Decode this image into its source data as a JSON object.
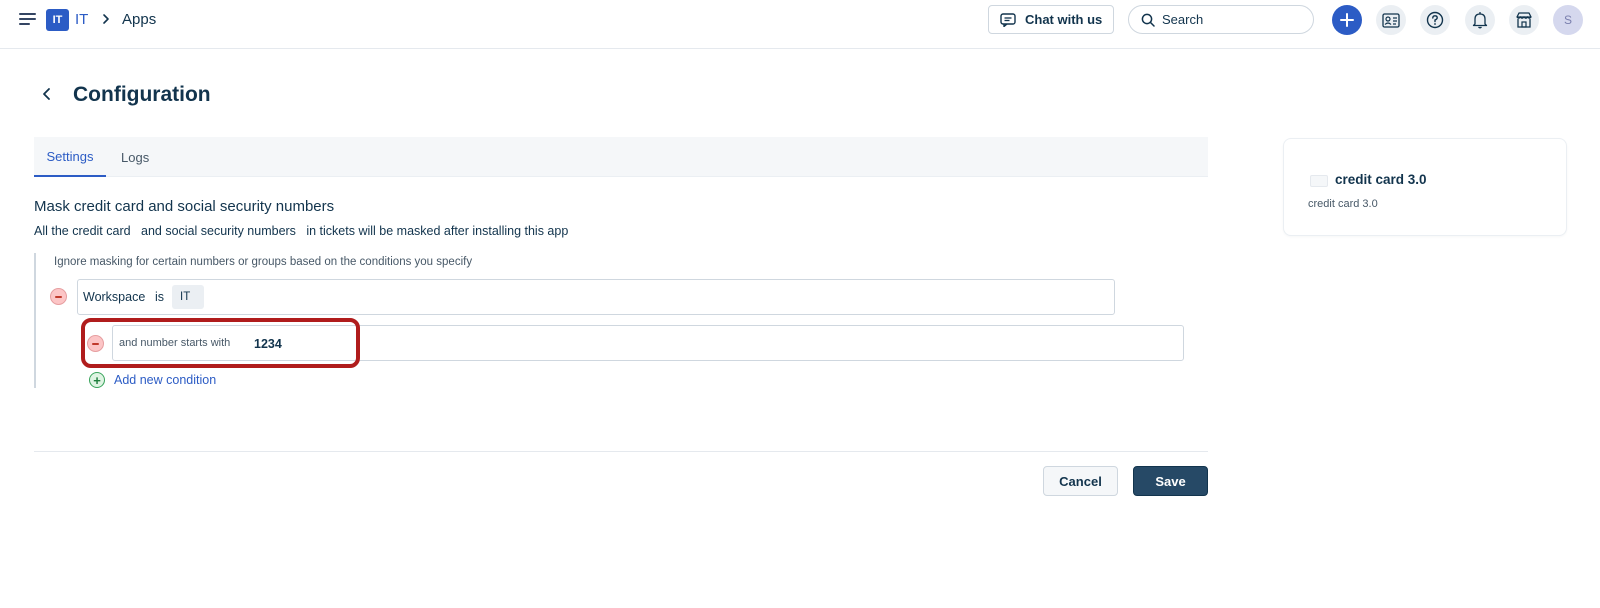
{
  "header": {
    "workspace_badge": "IT",
    "workspace_name": "IT",
    "breadcrumb_current": "Apps",
    "chat_label": "Chat with us",
    "search_placeholder": "Search",
    "avatar_initial": "S",
    "accent_color": "#2c5cc5",
    "icons": [
      "menu-icon",
      "chevron-right-icon",
      "chat-icon",
      "search-icon",
      "plus-icon",
      "contact-card-icon",
      "help-icon",
      "bell-icon",
      "store-icon"
    ]
  },
  "page": {
    "title": "Configuration",
    "tabs": [
      {
        "label": "Settings",
        "active": true
      },
      {
        "label": "Logs",
        "active": false
      }
    ]
  },
  "section": {
    "title": "Mask credit card and social security numbers",
    "desc_prefix": "All the ",
    "desc_highlight1": "credit card",
    "desc_mid": "   and ",
    "desc_highlight2": "social security numbers",
    "desc_suffix": "   in tickets will be masked after installing this app",
    "hint": "Ignore masking for certain numbers or groups based on the conditions you specify"
  },
  "conditions": {
    "row1": {
      "field": "Workspace",
      "operator": "is",
      "value": "IT"
    },
    "row2": {
      "label": "and number starts with",
      "value": "1234"
    },
    "add_label": "Add new condition"
  },
  "footer": {
    "cancel_label": "Cancel",
    "save_label": "Save"
  },
  "app_card": {
    "name": "credit card 3.0",
    "subtitle": "credit card 3.0"
  }
}
